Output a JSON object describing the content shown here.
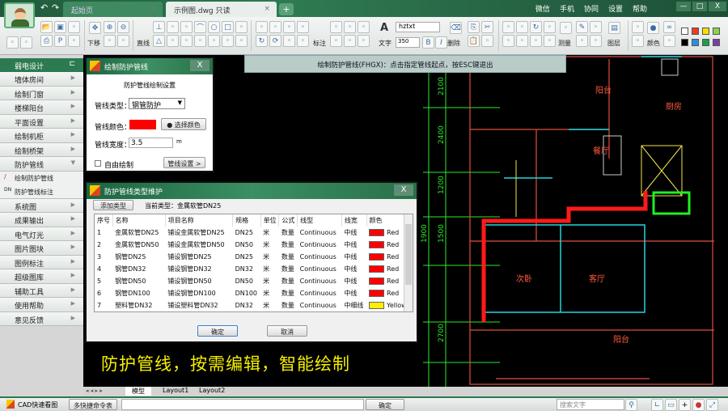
{
  "titlebar": {
    "tabs": [
      {
        "label": "起始页"
      },
      {
        "label": "示例图.dwg 只读"
      }
    ],
    "links": [
      "微信",
      "手机",
      "协同",
      "设置",
      "帮助"
    ],
    "window": [
      "—",
      "□",
      "X"
    ]
  },
  "toolbar": {
    "labels": {
      "move": "下移",
      "line": "直线",
      "dim": "标注",
      "text": "文字",
      "erase": "删除",
      "measure": "测量",
      "layer": "图层",
      "color": "颜色"
    },
    "font": "hztxt",
    "size": "350",
    "bold": "B",
    "italic": "I",
    "colors": [
      "#ffffff",
      "#e8401c",
      "#f4e000",
      "#8fd14f",
      "#000000",
      "#2d8fdc",
      "#16a34a",
      "#7b3fa8"
    ]
  },
  "sidebar": {
    "header": "弱电设计",
    "items": [
      "墙体房间",
      "绘制门窗",
      "楼梯阳台",
      "平面设置",
      "绘制机柜",
      "绘制桥架",
      "防护管线"
    ],
    "sub": [
      "绘制防护管线",
      "防护管线标注"
    ],
    "items2": [
      "系统图",
      "成果输出",
      "电气灯光",
      "图片图块",
      "图例标注",
      "超级图库",
      "辅助工具",
      "使用帮助",
      "意见反馈"
    ]
  },
  "hint": "绘制防护管线(FHGX)：点击指定管线起点，按ESC键退出",
  "dialog1": {
    "title": "绘制防护管线",
    "section": "防护管线绘制设置",
    "type_label": "管线类型：",
    "type_value": "钢管防护",
    "color_label": "管线颜色：",
    "color_value": "#ff0000",
    "color_btn": "选择颜色",
    "width_label": "管线宽度：",
    "width_value": "3.5",
    "width_unit": "m",
    "free_label": "自由绘制",
    "settings_btn": "管线设置 >"
  },
  "dialog2": {
    "title": "防护管线类型维护",
    "add_btn": "添加类型",
    "current": "当前类型：金属软管DN25",
    "columns": [
      "序号",
      "名称",
      "项目名称",
      "规格",
      "单位",
      "公式",
      "线型",
      "线宽",
      "颜色"
    ],
    "rows": [
      [
        "1",
        "金属软管DN25",
        "铺设金属软管DN25",
        "DN25",
        "米",
        "数量",
        "Continuous",
        "中线",
        "Red",
        "#ff0000"
      ],
      [
        "2",
        "金属软管DN50",
        "铺设金属软管DN50",
        "DN50",
        "米",
        "数量",
        "Continuous",
        "中线",
        "Red",
        "#ff0000"
      ],
      [
        "3",
        "钢管DN25",
        "铺设钢管DN25",
        "DN25",
        "米",
        "数量",
        "Continuous",
        "中线",
        "Red",
        "#ff0000"
      ],
      [
        "4",
        "钢管DN32",
        "铺设钢管DN32",
        "DN32",
        "米",
        "数量",
        "Continuous",
        "中线",
        "Red",
        "#ff0000"
      ],
      [
        "5",
        "钢管DN50",
        "铺设钢管DN50",
        "DN50",
        "米",
        "数量",
        "Continuous",
        "中线",
        "Red",
        "#ff0000"
      ],
      [
        "6",
        "钢管DN100",
        "铺设钢管DN100",
        "DN100",
        "米",
        "数量",
        "Continuous",
        "中线",
        "Red",
        "#ff0000"
      ],
      [
        "7",
        "塑料管DN32",
        "铺设塑料管DN32",
        "DN32",
        "米",
        "数量",
        "Continuous",
        "中细线",
        "Yellow",
        "#ffee00"
      ]
    ],
    "ok": "确定",
    "cancel": "取消"
  },
  "drawing": {
    "dims": [
      "2100",
      "2400",
      "1200",
      "1500",
      "1900",
      "2700"
    ],
    "rooms": [
      "阳台",
      "厨房",
      "餐厅",
      "客厅",
      "次卧",
      "阳台"
    ]
  },
  "slogan": "防护管线，按需编辑，智能绘制",
  "layouts": [
    "模型",
    "Layout1",
    "Layout2"
  ],
  "status": {
    "app": "CAD快速看图",
    "cmd_btn": "多快捷命令表",
    "cmd_value": "",
    "confirm": "确定",
    "search_placeholder": "搜索文字"
  }
}
